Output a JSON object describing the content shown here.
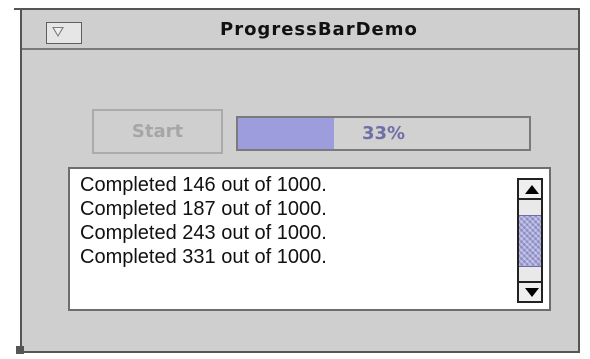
{
  "window": {
    "title": "ProgressBarDemo"
  },
  "controls": {
    "start_label": "Start"
  },
  "progress": {
    "value": 0.33,
    "label": "33%"
  },
  "log": {
    "lines": [
      "Completed 146 out of 1000.",
      "Completed 187 out of 1000.",
      "Completed 243 out of 1000.",
      "Completed 331 out of 1000."
    ]
  },
  "scrollbar": {
    "position": 0.5,
    "visible_fraction": 0.64
  },
  "colors": {
    "window_background": "#cfcfcf",
    "progress_fill": "#9d9ddd",
    "progress_text": "#6f6fa8",
    "disabled_button_text": "#a6a6a6"
  },
  "icons": {
    "collapse": "collapse-triangle-icon",
    "scroll_up": "arrow-up-icon",
    "scroll_down": "arrow-down-icon"
  }
}
